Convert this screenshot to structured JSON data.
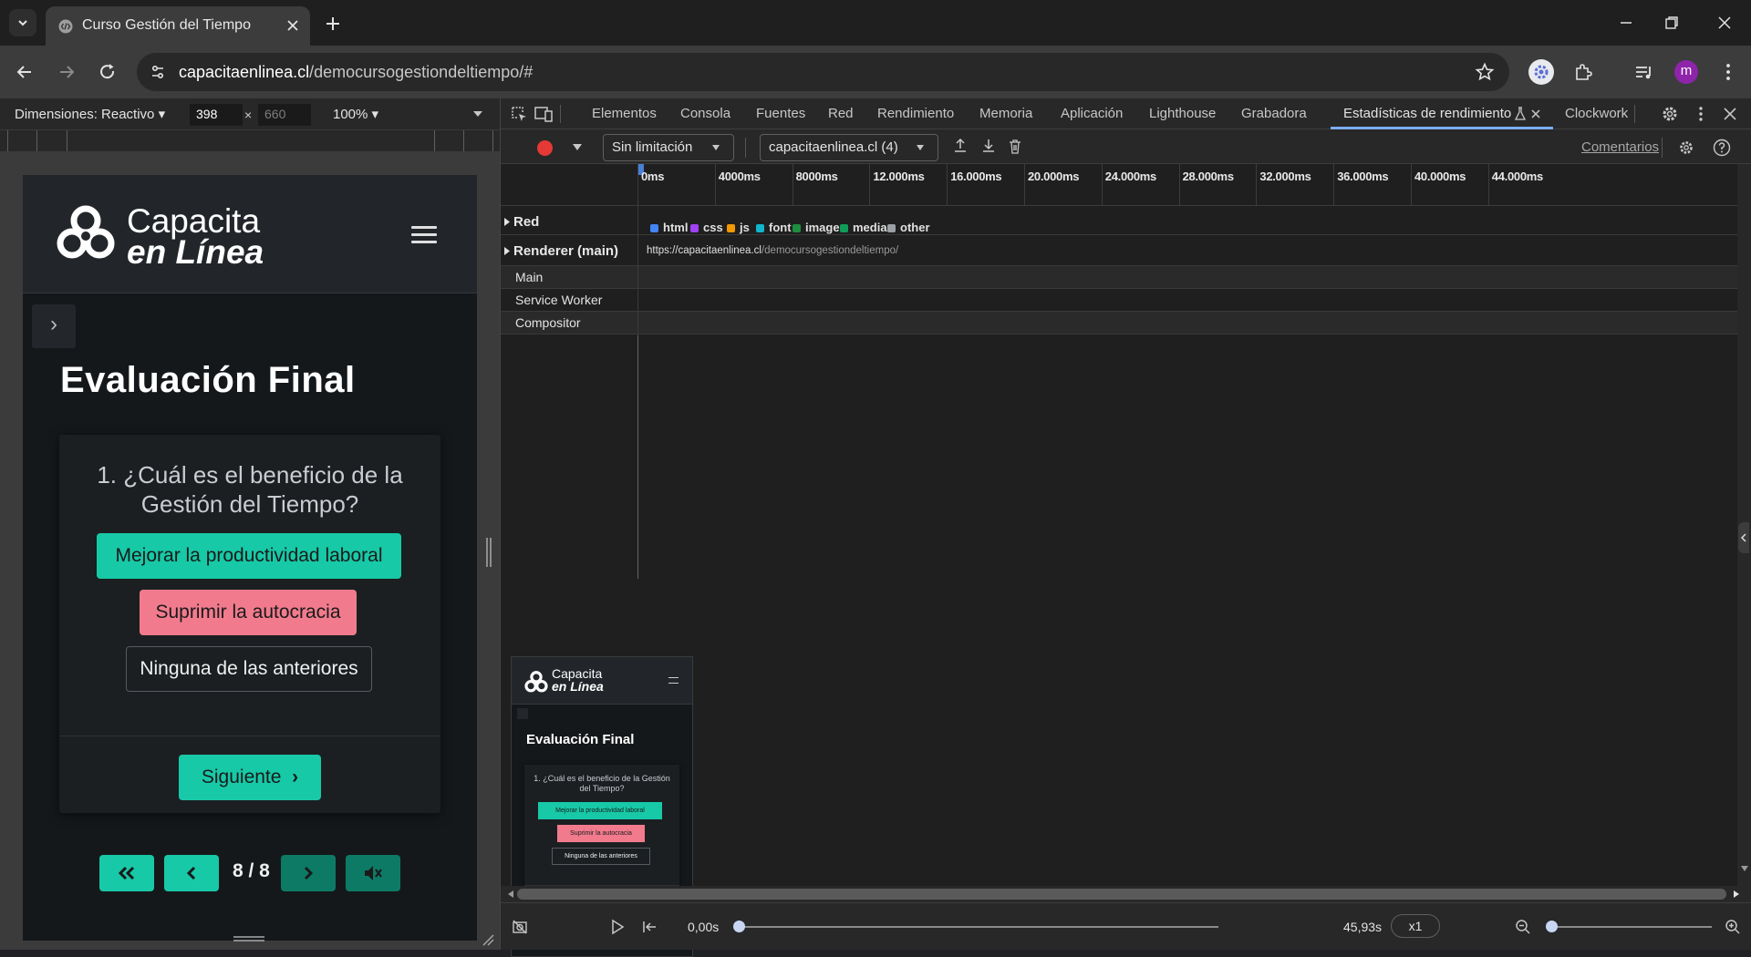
{
  "browser": {
    "tab_title": "Curso Gestión del Tiempo",
    "url_host": "capacitaenlinea.cl",
    "url_path": "/democursogestiondeltiempo/#",
    "avatar_letter": "m"
  },
  "device_toolbar": {
    "dimensions_label": "Dimensiones: Reactivo ▾",
    "width": "398",
    "times": "×",
    "height": "660",
    "zoom": "100% ▾"
  },
  "page": {
    "logo_line1": "Capacita",
    "logo_line2": "en Línea",
    "title": "Evaluación Final",
    "question": "1. ¿Cuál es el beneficio de la Gestión del Tiempo?",
    "answers": [
      "Mejorar la productividad laboral",
      "Suprimir la autocracia",
      "Ninguna de las anteriores"
    ],
    "next_label": "Siguiente",
    "page_indicator": "8 / 8"
  },
  "devtools": {
    "tabs": [
      "Elementos",
      "Consola",
      "Fuentes",
      "Red",
      "Rendimiento",
      "Memoria",
      "Aplicación",
      "Lighthouse",
      "Grabadora",
      "Estadísticas de rendimiento",
      "Clockwork"
    ],
    "throttle": "Sin limitación",
    "target": "capacitaenlinea.cl (4)",
    "feedback": "Comentarios",
    "ruler_ticks": [
      "0ms",
      "4000ms",
      "8000ms",
      "12.000ms",
      "16.000ms",
      "20.000ms",
      "24.000ms",
      "28.000ms",
      "32.000ms",
      "36.000ms",
      "40.000ms",
      "44.000ms"
    ],
    "tracks": {
      "network": "Red",
      "renderer": "Renderer (main)",
      "renderer_url_host": "https://capacitaenlinea.cl",
      "renderer_url_path": "/democursogestiondeltiempo/",
      "subtracks": [
        "Main",
        "Service Worker",
        "Compositor"
      ]
    },
    "legend": [
      {
        "label": "html",
        "color": "#4285f4"
      },
      {
        "label": "css",
        "color": "#a142f4"
      },
      {
        "label": "js",
        "color": "#f29900"
      },
      {
        "label": "font",
        "color": "#12b5cb"
      },
      {
        "label": "image",
        "color": "#1e8e3e"
      },
      {
        "label": "media",
        "color": "#0f9d58"
      },
      {
        "label": "other",
        "color": "#9aa0a6"
      }
    ],
    "time_start": "0,00s",
    "time_end": "45,93s",
    "speed": "x1"
  },
  "colors": {
    "accent": "#17c9a7",
    "pink": "#f17b8d",
    "record": "#e53935"
  }
}
